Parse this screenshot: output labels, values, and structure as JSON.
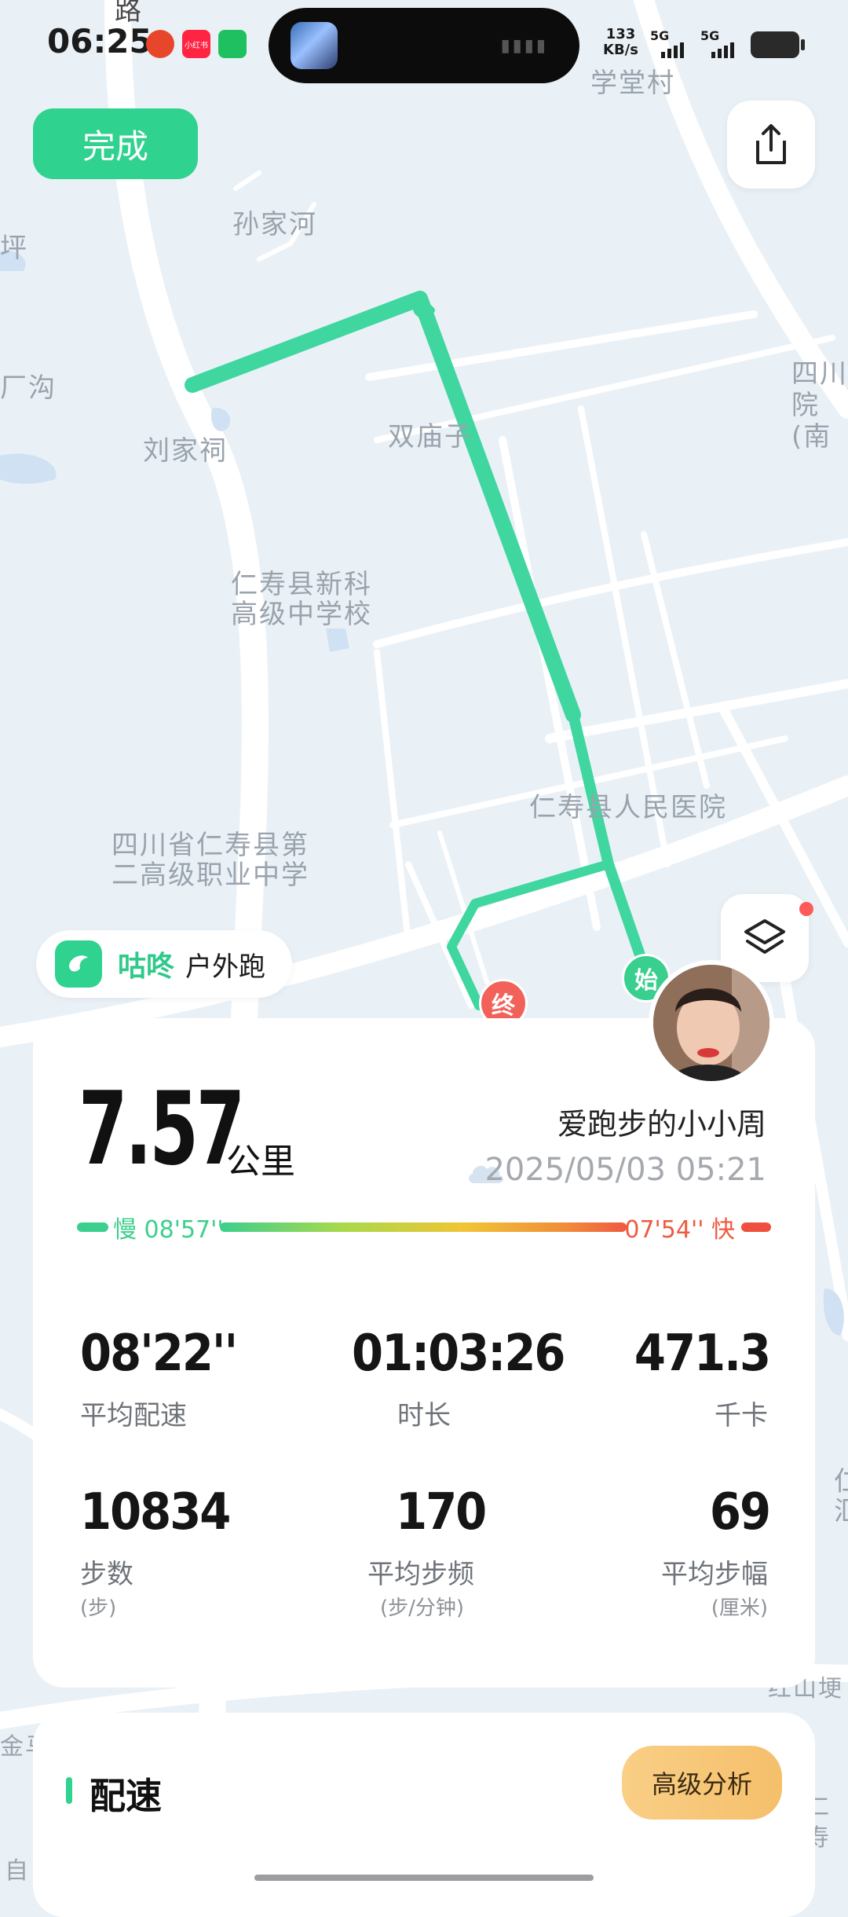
{
  "status_bar": {
    "time": "06:25",
    "net_speed_value": "133",
    "net_speed_unit": "KB/s",
    "sim1": "5G",
    "sim2": "5G",
    "app_icon_2": "小红书"
  },
  "map": {
    "labels": [
      "路",
      "学堂村",
      "孙家河",
      "坪",
      "厂沟",
      "刘家祠",
      "双庙子",
      "四川",
      "院(南",
      "仁寿县新科",
      "高级中学校",
      "仁寿县人民医院",
      "四川省仁寿县第",
      "二高级职业中学",
      "红山埂",
      "仁寿",
      "金马",
      "自",
      "仁",
      "汇"
    ],
    "route_color": "#3fd6a0",
    "start_marker": "始",
    "end_marker": "终"
  },
  "toolbar": {
    "done_label": "完成",
    "share_icon": "share-icon",
    "layers_icon": "layers-icon"
  },
  "brand": {
    "name": "咕咚",
    "activity": "户外跑"
  },
  "summary": {
    "distance": "7.57",
    "distance_unit": "公里",
    "username": "爱跑步的小小周",
    "datetime": "2025/05/03 05:21",
    "weather_icon": "cloud-icon",
    "pace_slow": "慢 08'57''",
    "pace_fast": "07'54'' 快"
  },
  "metrics": [
    {
      "value": "08'22''",
      "label": "平均配速",
      "sub": ""
    },
    {
      "value": "01:03:26",
      "label": "时长",
      "sub": ""
    },
    {
      "value": "471.3",
      "label": "千卡",
      "sub": ""
    },
    {
      "value": "10834",
      "label": "步数",
      "sub": "(步)"
    },
    {
      "value": "170",
      "label": "平均步频",
      "sub": "(步/分钟)"
    },
    {
      "value": "69",
      "label": "平均步幅",
      "sub": "(厘米)"
    }
  ],
  "pace_section": {
    "title": "配速",
    "advanced_label": "高级分析"
  },
  "colors": {
    "accent": "#2fd28f",
    "slow": "#3ccf8e",
    "fast": "#ef5a40"
  }
}
